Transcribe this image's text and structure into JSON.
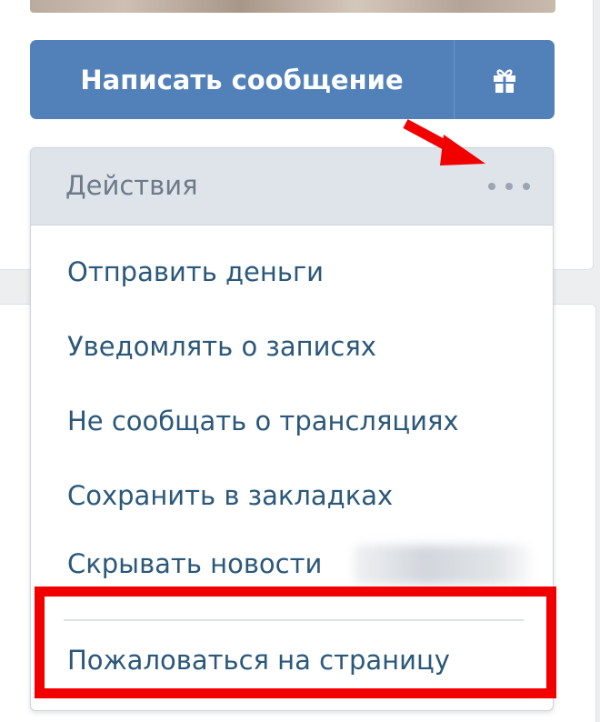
{
  "buttons": {
    "message_label": "Написать сообщение"
  },
  "icons": {
    "gift": "gift-icon",
    "more": "more-dots-icon",
    "arrow": "red-arrow-annotation"
  },
  "actions": {
    "header_label": "Действия",
    "items": [
      {
        "label": "Отправить деньги"
      },
      {
        "label": "Уведомлять о записях"
      },
      {
        "label": "Не сообщать о трансляциях"
      },
      {
        "label": "Сохранить в закладках"
      },
      {
        "label": "Скрывать новости"
      },
      {
        "label": "Пожаловаться на страницу"
      }
    ]
  },
  "colors": {
    "accent": "#5181b8",
    "link": "#2b587a",
    "header_bg": "#dfe4ea",
    "header_text": "#6c7a89",
    "annotation": "#f20000"
  }
}
